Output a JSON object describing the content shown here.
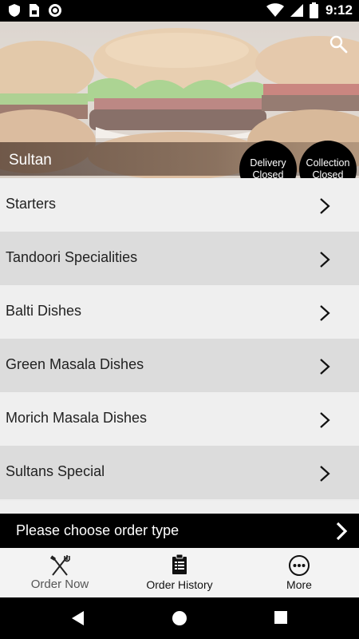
{
  "status_bar": {
    "time": "9:12",
    "left_icons": [
      "shield-icon",
      "sim-card-icon",
      "record-icon"
    ],
    "right_icons": [
      "wifi-icon",
      "signal-icon",
      "battery-icon"
    ]
  },
  "header": {
    "restaurant_name": "Sultan",
    "search_icon": "search-icon",
    "delivery_status": {
      "line1": "Delivery",
      "line2": "Closed"
    },
    "collection_status": {
      "line1": "Collection",
      "line2": "Closed"
    }
  },
  "menu": {
    "categories": [
      {
        "label": "Starters"
      },
      {
        "label": "Tandoori Specialities"
      },
      {
        "label": "Balti Dishes"
      },
      {
        "label": "Green Masala Dishes"
      },
      {
        "label": "Morich Masala Dishes"
      },
      {
        "label": "Sultans Special"
      }
    ],
    "chevron_icon": "chevron-right-icon"
  },
  "order_bar": {
    "label": "Please choose order type",
    "icon": "chevron-right-icon"
  },
  "bottom_nav": {
    "tabs": [
      {
        "label": "Order Now",
        "icon": "fork-knife-icon"
      },
      {
        "label": "Order History",
        "icon": "clipboard-icon"
      },
      {
        "label": "More",
        "icon": "more-dots-icon"
      }
    ]
  },
  "system_nav": {
    "buttons": [
      "back-icon",
      "home-icon",
      "recents-icon"
    ]
  },
  "colors": {
    "bar_background": "#000000",
    "row_light": "#efefef",
    "row_dark": "#dcdcdc",
    "nav_background": "#f3f3f3"
  }
}
